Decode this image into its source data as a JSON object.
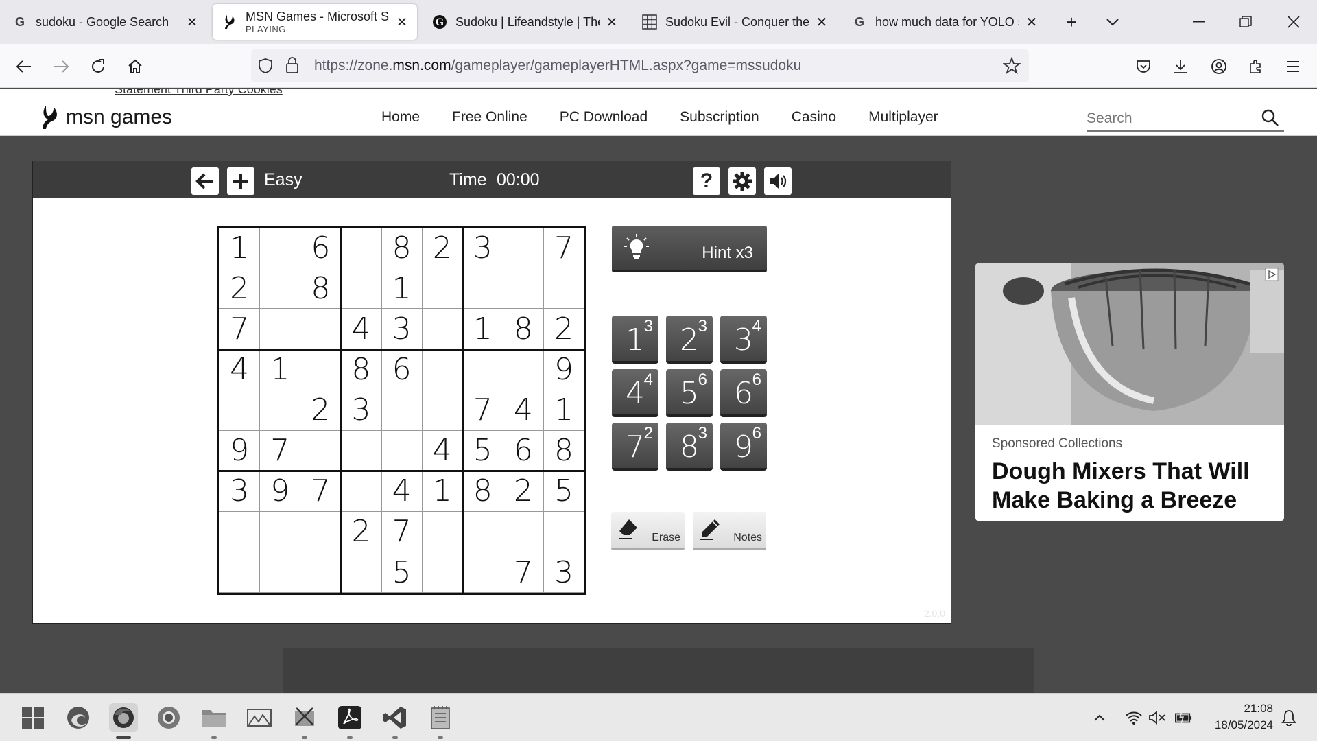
{
  "browser": {
    "tabs": [
      {
        "title": "sudoku - Google Search",
        "icon": "google-icon",
        "active": false
      },
      {
        "title": "MSN Games - Microsoft Sudoku",
        "subtitle": "PLAYING",
        "icon": "msn-icon",
        "active": true
      },
      {
        "title": "Sudoku | Lifeandstyle | The Guardian",
        "icon": "guardian-icon",
        "active": false
      },
      {
        "title": "Sudoku Evil - Conquer the Hardest",
        "icon": "grid-icon",
        "active": false
      },
      {
        "title": "how much data for YOLO size",
        "icon": "google-icon",
        "active": false
      }
    ],
    "url_prefix": "https://zone.",
    "url_host": "msn.com",
    "url_rest": "/gameplayer/gameplayerHTML.aspx?game=mssudoku"
  },
  "msn": {
    "top_strip_text": "Statement  Third Party Cookies",
    "logo_text": "msn games",
    "nav": [
      "Home",
      "Free Online",
      "PC Download",
      "Subscription",
      "Casino",
      "Multiplayer"
    ],
    "search_placeholder": "Search"
  },
  "game": {
    "difficulty": "Easy",
    "time_label": "Time",
    "time_value": "00:00",
    "hint_label": "Hint x3",
    "erase_label": "Erase",
    "notes_label": "Notes",
    "version": "2.0.0",
    "grid": [
      [
        "1",
        "",
        "6",
        "",
        "8",
        "2",
        "3",
        "",
        "7"
      ],
      [
        "2",
        "",
        "8",
        "",
        "1",
        "",
        "",
        "",
        ""
      ],
      [
        "7",
        "",
        "",
        "4",
        "3",
        "",
        "1",
        "8",
        "2"
      ],
      [
        "4",
        "1",
        "",
        "8",
        "6",
        "",
        "",
        "",
        "9"
      ],
      [
        "",
        "",
        "2",
        "3",
        "",
        "",
        "7",
        "4",
        "1"
      ],
      [
        "9",
        "7",
        "",
        "",
        "",
        "4",
        "5",
        "6",
        "8"
      ],
      [
        "3",
        "9",
        "7",
        "",
        "4",
        "1",
        "8",
        "2",
        "5"
      ],
      [
        "",
        "",
        "",
        "2",
        "7",
        "",
        "",
        "",
        ""
      ],
      [
        "",
        "",
        "",
        "",
        "5",
        "",
        "",
        "7",
        "3"
      ]
    ],
    "number_pad": [
      {
        "num": "1",
        "remaining": "3"
      },
      {
        "num": "2",
        "remaining": "3"
      },
      {
        "num": "3",
        "remaining": "4"
      },
      {
        "num": "4",
        "remaining": "4"
      },
      {
        "num": "5",
        "remaining": "6"
      },
      {
        "num": "6",
        "remaining": "6"
      },
      {
        "num": "7",
        "remaining": "2"
      },
      {
        "num": "8",
        "remaining": "3"
      },
      {
        "num": "9",
        "remaining": "6"
      }
    ]
  },
  "ad": {
    "sponsor": "Sponsored Collections",
    "title": "Dough Mixers That Will Make Baking a Breeze"
  },
  "taskbar": {
    "time": "21:08",
    "date": "18/05/2024"
  }
}
